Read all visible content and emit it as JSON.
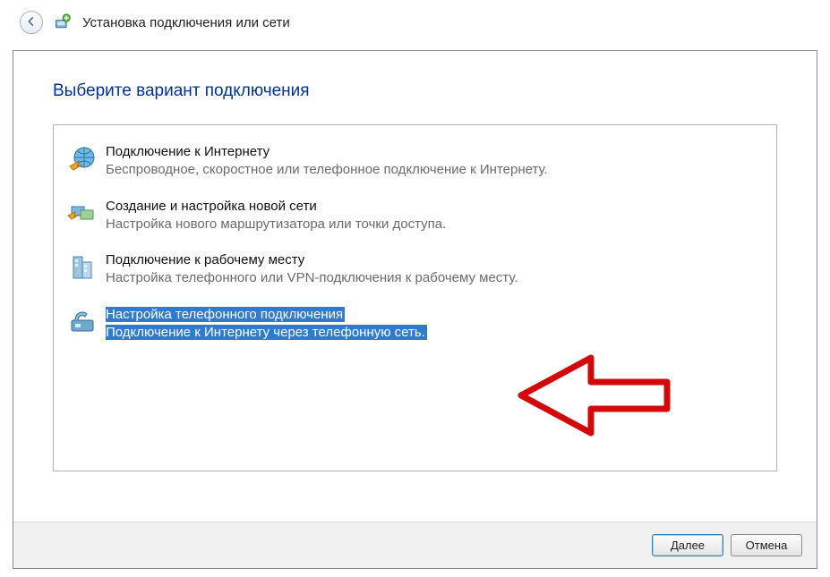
{
  "window": {
    "title": "Установка подключения или сети",
    "back_icon": "back-arrow-icon",
    "app_icon": "network-plus-icon"
  },
  "heading": "Выберите вариант подключения",
  "options": [
    {
      "icon": "globe-connect-icon",
      "title": "Подключение к Интернету",
      "desc": "Беспроводное, скоростное или телефонное подключение к Интернету.",
      "selected": false
    },
    {
      "icon": "router-new-icon",
      "title": "Создание и настройка новой сети",
      "desc": "Настройка нового маршрутизатора или точки доступа.",
      "selected": false
    },
    {
      "icon": "building-connect-icon",
      "title": "Подключение к рабочему месту",
      "desc": "Настройка телефонного или VPN-подключения к рабочему месту.",
      "selected": false
    },
    {
      "icon": "dialup-modem-icon",
      "title": "Настройка телефонного подключения",
      "desc": "Подключение к Интернету через телефонную сеть.",
      "selected": true
    }
  ],
  "buttons": {
    "next": "Далее",
    "cancel": "Отмена"
  }
}
